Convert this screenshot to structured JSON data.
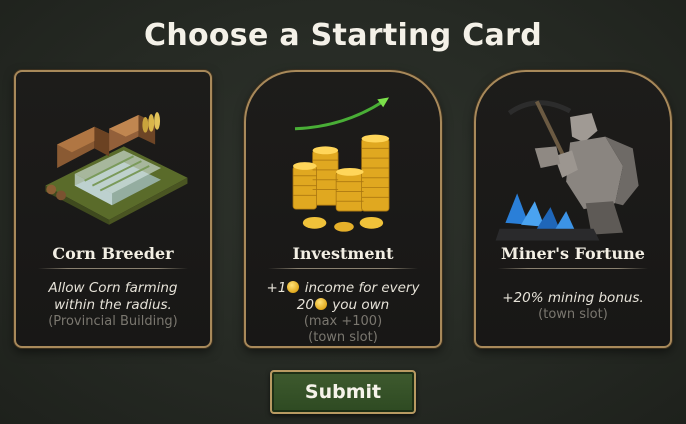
{
  "title": "Choose a Starting Card",
  "cards": [
    {
      "name": "Corn Breeder",
      "description": "Allow Corn farming within the radius.",
      "sub": "(Provincial Building)"
    },
    {
      "name": "Investment",
      "desc_prefix": "+1",
      "desc_middle": " income for every ",
      "desc_count": "20",
      "desc_suffix": " you own",
      "sub1": "(max +100)",
      "sub2": "(town slot)"
    },
    {
      "name": "Miner's Fortune",
      "description": "+20% mining bonus.",
      "sub": "(town slot)"
    }
  ],
  "submit_label": "Submit",
  "colors": {
    "card_border": "#a8895a",
    "submit_bg": "#3e5a2e",
    "coin": "#e1a91d"
  }
}
